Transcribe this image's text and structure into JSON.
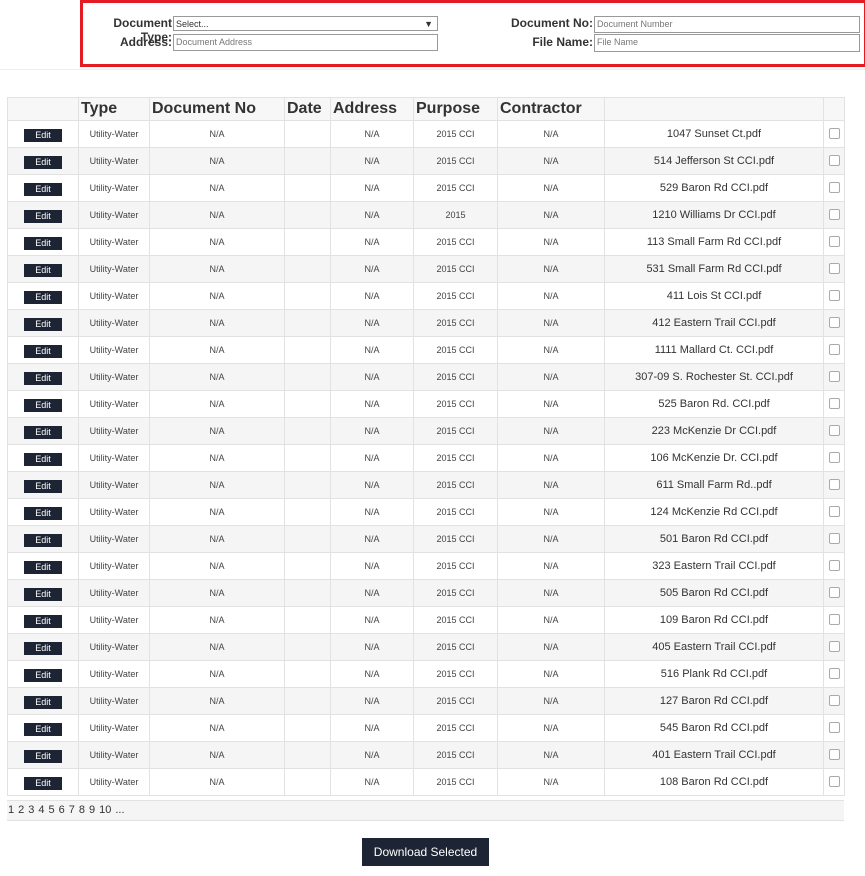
{
  "filters": {
    "document_type_label": "Document Type:",
    "document_type_value": "Select...",
    "address_label": "Address:",
    "address_placeholder": "Document Address",
    "document_no_label": "Document No:",
    "document_no_placeholder": "Document Number",
    "file_name_label": "File Name:",
    "file_name_placeholder": "File Name"
  },
  "table": {
    "headers": [
      "",
      "Type",
      "Document No",
      "Date",
      "Address",
      "Purpose",
      "Contractor",
      "",
      ""
    ],
    "edit_label": "Edit",
    "rows": [
      {
        "type": "Utility-Water",
        "doc_no": "N/A",
        "date": "",
        "address": "N/A",
        "purpose": "2015 CCI",
        "contractor": "N/A",
        "file": "1047 Sunset Ct.pdf"
      },
      {
        "type": "Utility-Water",
        "doc_no": "N/A",
        "date": "",
        "address": "N/A",
        "purpose": "2015 CCI",
        "contractor": "N/A",
        "file": "514 Jefferson St CCI.pdf"
      },
      {
        "type": "Utility-Water",
        "doc_no": "N/A",
        "date": "",
        "address": "N/A",
        "purpose": "2015 CCI",
        "contractor": "N/A",
        "file": "529 Baron Rd CCI.pdf"
      },
      {
        "type": "Utility-Water",
        "doc_no": "N/A",
        "date": "",
        "address": "N/A",
        "purpose": "2015",
        "contractor": "N/A",
        "file": "1210 Williams Dr CCI.pdf"
      },
      {
        "type": "Utility-Water",
        "doc_no": "N/A",
        "date": "",
        "address": "N/A",
        "purpose": "2015 CCI",
        "contractor": "N/A",
        "file": "113 Small Farm Rd CCI.pdf"
      },
      {
        "type": "Utility-Water",
        "doc_no": "N/A",
        "date": "",
        "address": "N/A",
        "purpose": "2015 CCI",
        "contractor": "N/A",
        "file": "531 Small Farm Rd CCI.pdf"
      },
      {
        "type": "Utility-Water",
        "doc_no": "N/A",
        "date": "",
        "address": "N/A",
        "purpose": "2015 CCI",
        "contractor": "N/A",
        "file": "411 Lois St CCI.pdf"
      },
      {
        "type": "Utility-Water",
        "doc_no": "N/A",
        "date": "",
        "address": "N/A",
        "purpose": "2015 CCI",
        "contractor": "N/A",
        "file": "412 Eastern Trail CCI.pdf"
      },
      {
        "type": "Utility-Water",
        "doc_no": "N/A",
        "date": "",
        "address": "N/A",
        "purpose": "2015 CCI",
        "contractor": "N/A",
        "file": "1111 Mallard Ct. CCI.pdf"
      },
      {
        "type": "Utility-Water",
        "doc_no": "N/A",
        "date": "",
        "address": "N/A",
        "purpose": "2015 CCI",
        "contractor": "N/A",
        "file": "307-09 S. Rochester St. CCI.pdf"
      },
      {
        "type": "Utility-Water",
        "doc_no": "N/A",
        "date": "",
        "address": "N/A",
        "purpose": "2015 CCI",
        "contractor": "N/A",
        "file": "525 Baron Rd. CCI.pdf"
      },
      {
        "type": "Utility-Water",
        "doc_no": "N/A",
        "date": "",
        "address": "N/A",
        "purpose": "2015 CCI",
        "contractor": "N/A",
        "file": "223 McKenzie Dr CCI.pdf"
      },
      {
        "type": "Utility-Water",
        "doc_no": "N/A",
        "date": "",
        "address": "N/A",
        "purpose": "2015 CCI",
        "contractor": "N/A",
        "file": "106 McKenzie Dr. CCI.pdf"
      },
      {
        "type": "Utility-Water",
        "doc_no": "N/A",
        "date": "",
        "address": "N/A",
        "purpose": "2015 CCI",
        "contractor": "N/A",
        "file": "611 Small Farm Rd..pdf"
      },
      {
        "type": "Utility-Water",
        "doc_no": "N/A",
        "date": "",
        "address": "N/A",
        "purpose": "2015 CCI",
        "contractor": "N/A",
        "file": "124 McKenzie Rd CCI.pdf"
      },
      {
        "type": "Utility-Water",
        "doc_no": "N/A",
        "date": "",
        "address": "N/A",
        "purpose": "2015 CCI",
        "contractor": "N/A",
        "file": "501 Baron Rd CCI.pdf"
      },
      {
        "type": "Utility-Water",
        "doc_no": "N/A",
        "date": "",
        "address": "N/A",
        "purpose": "2015 CCI",
        "contractor": "N/A",
        "file": "323 Eastern Trail CCI.pdf"
      },
      {
        "type": "Utility-Water",
        "doc_no": "N/A",
        "date": "",
        "address": "N/A",
        "purpose": "2015 CCI",
        "contractor": "N/A",
        "file": "505 Baron Rd CCI.pdf"
      },
      {
        "type": "Utility-Water",
        "doc_no": "N/A",
        "date": "",
        "address": "N/A",
        "purpose": "2015 CCI",
        "contractor": "N/A",
        "file": "109 Baron Rd CCI.pdf"
      },
      {
        "type": "Utility-Water",
        "doc_no": "N/A",
        "date": "",
        "address": "N/A",
        "purpose": "2015 CCI",
        "contractor": "N/A",
        "file": "405 Eastern Trail CCI.pdf"
      },
      {
        "type": "Utility-Water",
        "doc_no": "N/A",
        "date": "",
        "address": "N/A",
        "purpose": "2015 CCI",
        "contractor": "N/A",
        "file": "516 Plank Rd CCI.pdf"
      },
      {
        "type": "Utility-Water",
        "doc_no": "N/A",
        "date": "",
        "address": "N/A",
        "purpose": "2015 CCI",
        "contractor": "N/A",
        "file": "127 Baron Rd CCI.pdf"
      },
      {
        "type": "Utility-Water",
        "doc_no": "N/A",
        "date": "",
        "address": "N/A",
        "purpose": "2015 CCI",
        "contractor": "N/A",
        "file": "545 Baron Rd CCI.pdf"
      },
      {
        "type": "Utility-Water",
        "doc_no": "N/A",
        "date": "",
        "address": "N/A",
        "purpose": "2015 CCI",
        "contractor": "N/A",
        "file": "401 Eastern Trail CCI.pdf"
      },
      {
        "type": "Utility-Water",
        "doc_no": "N/A",
        "date": "",
        "address": "N/A",
        "purpose": "2015 CCI",
        "contractor": "N/A",
        "file": "108 Baron Rd CCI.pdf"
      }
    ]
  },
  "pagination": [
    "1",
    "2",
    "3",
    "4",
    "5",
    "6",
    "7",
    "8",
    "9",
    "10",
    "..."
  ],
  "download_label": "Download Selected",
  "colors": {
    "highlight_border": "#e51b24",
    "button_bg": "#1d2433"
  }
}
